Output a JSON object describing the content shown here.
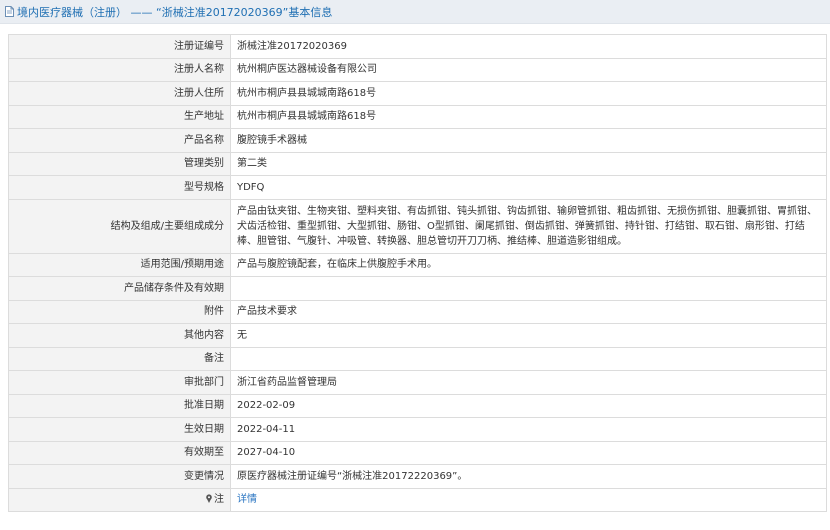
{
  "header": {
    "title": "境内医疗器械（注册） —— “浙械注准20172020369”基本信息"
  },
  "rows": [
    {
      "label": "注册证编号",
      "value": "浙械注准20172020369"
    },
    {
      "label": "注册人名称",
      "value": "杭州桐庐医达器械设备有限公司"
    },
    {
      "label": "注册人住所",
      "value": "杭州市桐庐县县城城南路618号"
    },
    {
      "label": "生产地址",
      "value": "杭州市桐庐县县城城南路618号"
    },
    {
      "label": "产品名称",
      "value": "腹腔镜手术器械"
    },
    {
      "label": "管理类别",
      "value": "第二类"
    },
    {
      "label": "型号规格",
      "value": "YDFQ"
    },
    {
      "label": "结构及组成/主要组成成分",
      "value": "产品由钛夹钳、生物夹钳、塑料夹钳、有齿抓钳、钝头抓钳、钩齿抓钳、输卵管抓钳、粗齿抓钳、无损伤抓钳、胆囊抓钳、胃抓钳、犬齿活检钳、重型抓钳、大型抓钳、肠钳、O型抓钳、阑尾抓钳、倒齿抓钳、弹簧抓钳、持针钳、打结钳、取石钳、扇形钳、打结棒、胆管钳、气腹针、冲吸管、转换器、胆总管切开刀刀柄、推结棒、胆道造影钳组成。"
    },
    {
      "label": "适用范围/预期用途",
      "value": "产品与腹腔镜配套，在临床上供腹腔手术用。"
    },
    {
      "label": "产品储存条件及有效期",
      "value": ""
    },
    {
      "label": "附件",
      "value": "产品技术要求"
    },
    {
      "label": "其他内容",
      "value": "无"
    },
    {
      "label": "备注",
      "value": ""
    },
    {
      "label": "审批部门",
      "value": "浙江省药品监督管理局"
    },
    {
      "label": "批准日期",
      "value": "2022-02-09"
    },
    {
      "label": "生效日期",
      "value": "2022-04-11"
    },
    {
      "label": "有效期至",
      "value": "2027-04-10"
    },
    {
      "label": "变更情况",
      "value": "原医疗器械注册证编号“浙械注准20172220369”。"
    }
  ],
  "note": {
    "label": "注",
    "icon": "pin-icon",
    "link_text": "详情"
  },
  "colors": {
    "header_bg": "#eaeef3",
    "header_text": "#1f6fb3",
    "label_bg": "#f3f3f3",
    "border": "#dcdcdc",
    "link": "#2a75c2"
  }
}
